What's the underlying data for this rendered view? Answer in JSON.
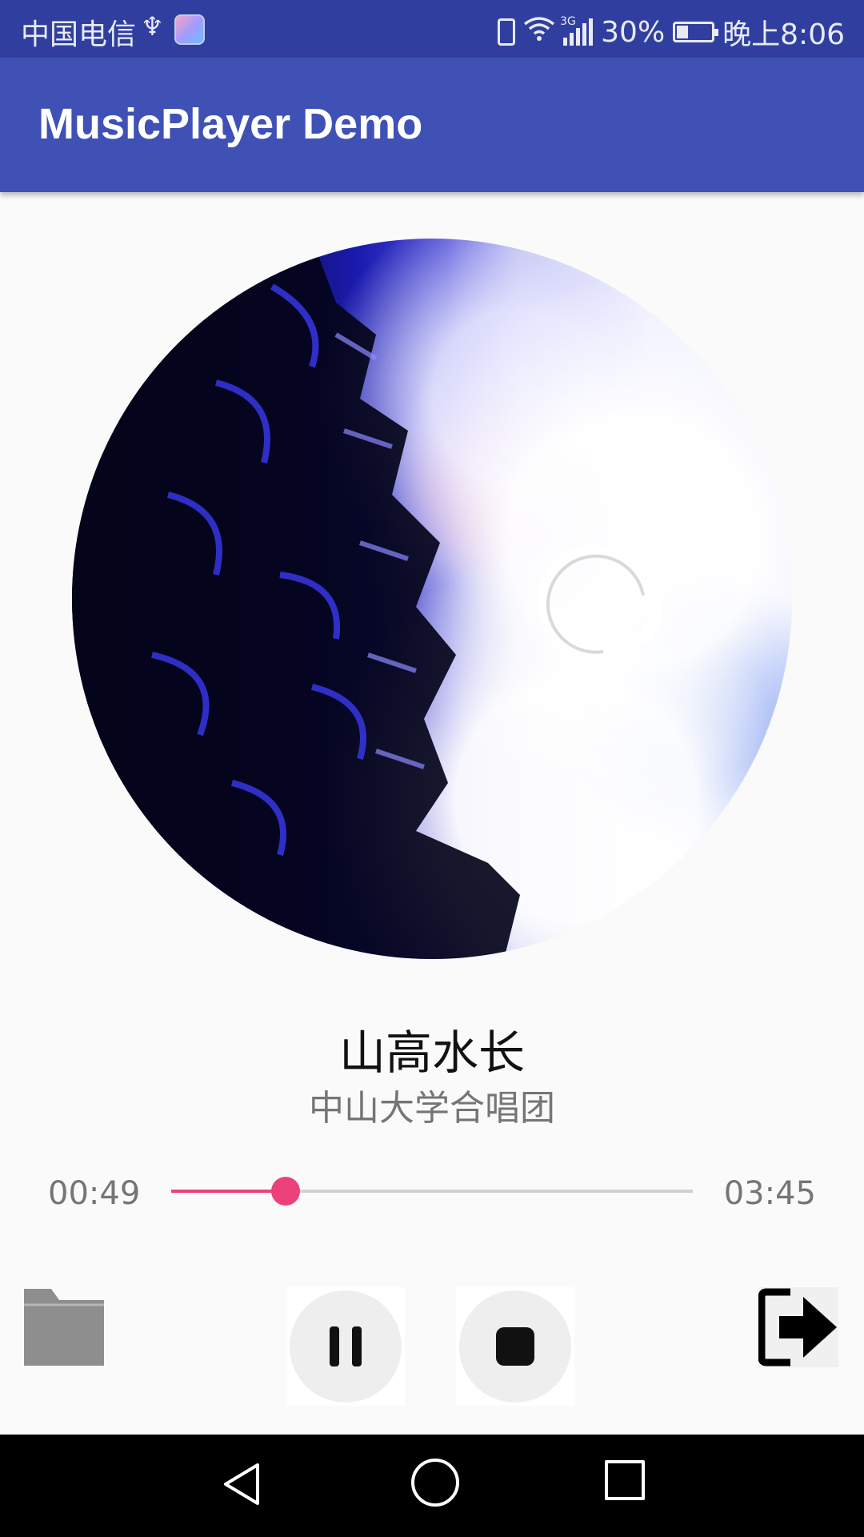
{
  "status_bar": {
    "carrier": "中国电信",
    "usb_symbol": "♆",
    "network_type": "3G",
    "battery": "30%",
    "time": "晚上8:06"
  },
  "app_bar": {
    "title": "MusicPlayer Demo"
  },
  "track": {
    "title": "山高水长",
    "artist": "中山大学合唱团"
  },
  "progress": {
    "current": "00:49",
    "total": "03:45",
    "fraction": 0.22
  },
  "controls": {
    "folder": "folder-icon",
    "pause": "pause-icon",
    "stop": "stop-icon",
    "exit": "exit-icon"
  },
  "colors": {
    "status_bar": "#303f9f",
    "app_bar": "#3f51b5",
    "accent": "#ec407a",
    "background": "#fafafa"
  }
}
